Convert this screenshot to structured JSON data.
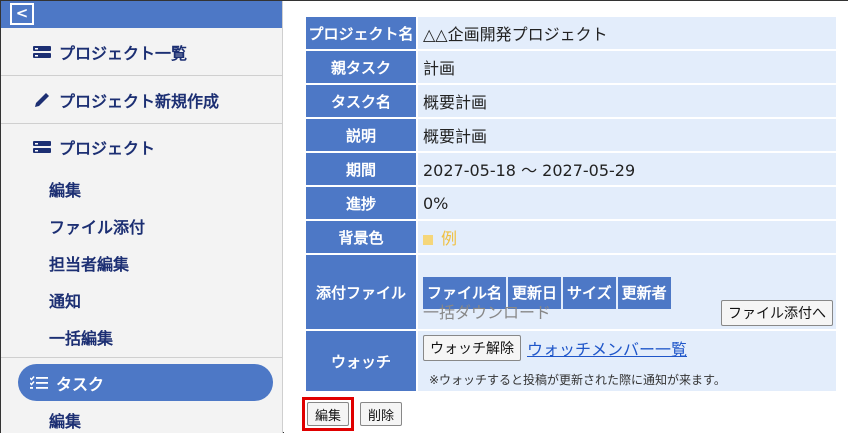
{
  "sidebar": {
    "back_icon": "chevron-left-icon",
    "items": [
      {
        "label": "プロジェクト一覧",
        "icon": "list-icon"
      },
      {
        "label": "プロジェクト新規作成",
        "icon": "pencil-icon"
      }
    ],
    "project": {
      "label": "プロジェクト",
      "icon": "list-icon",
      "sub_items": [
        "編集",
        "ファイル添付",
        "担当者編集",
        "通知",
        "一括編集"
      ]
    },
    "task": {
      "label": "タスク",
      "icon": "checklist-icon",
      "sub_items": [
        "編集"
      ]
    }
  },
  "detail": {
    "rows": [
      {
        "label": "プロジェクト名",
        "value": "△△企画開発プロジェクト"
      },
      {
        "label": "親タスク",
        "value": "計画"
      },
      {
        "label": "タスク名",
        "value": "概要計画"
      },
      {
        "label": "説明",
        "value": "概要計画"
      },
      {
        "label": "期間",
        "value": "2027-05-18 ～ 2027-05-29"
      },
      {
        "label": "進捗",
        "value": "0%"
      }
    ],
    "bg_color": {
      "label": "背景色",
      "example": "例",
      "swatch_color": "#f5d67a"
    },
    "attachments": {
      "label": "添付ファイル",
      "columns": [
        "ファイル名",
        "更新日",
        "サイズ",
        "更新者"
      ],
      "bulk_download": "一括ダウンロード",
      "attach_button": "ファイル添付へ"
    },
    "watch": {
      "label": "ウォッチ",
      "unwatch_button": "ウォッチ解除",
      "members_link": "ウォッチメンバー一覧",
      "note": "※ウォッチすると投稿が更新された際に通知が来ます。"
    }
  },
  "actions": {
    "edit": "編集",
    "delete": "削除"
  },
  "colors": {
    "accent": "#4d78c6",
    "highlight": "#e00000",
    "cell_bg": "#e3edfb"
  }
}
